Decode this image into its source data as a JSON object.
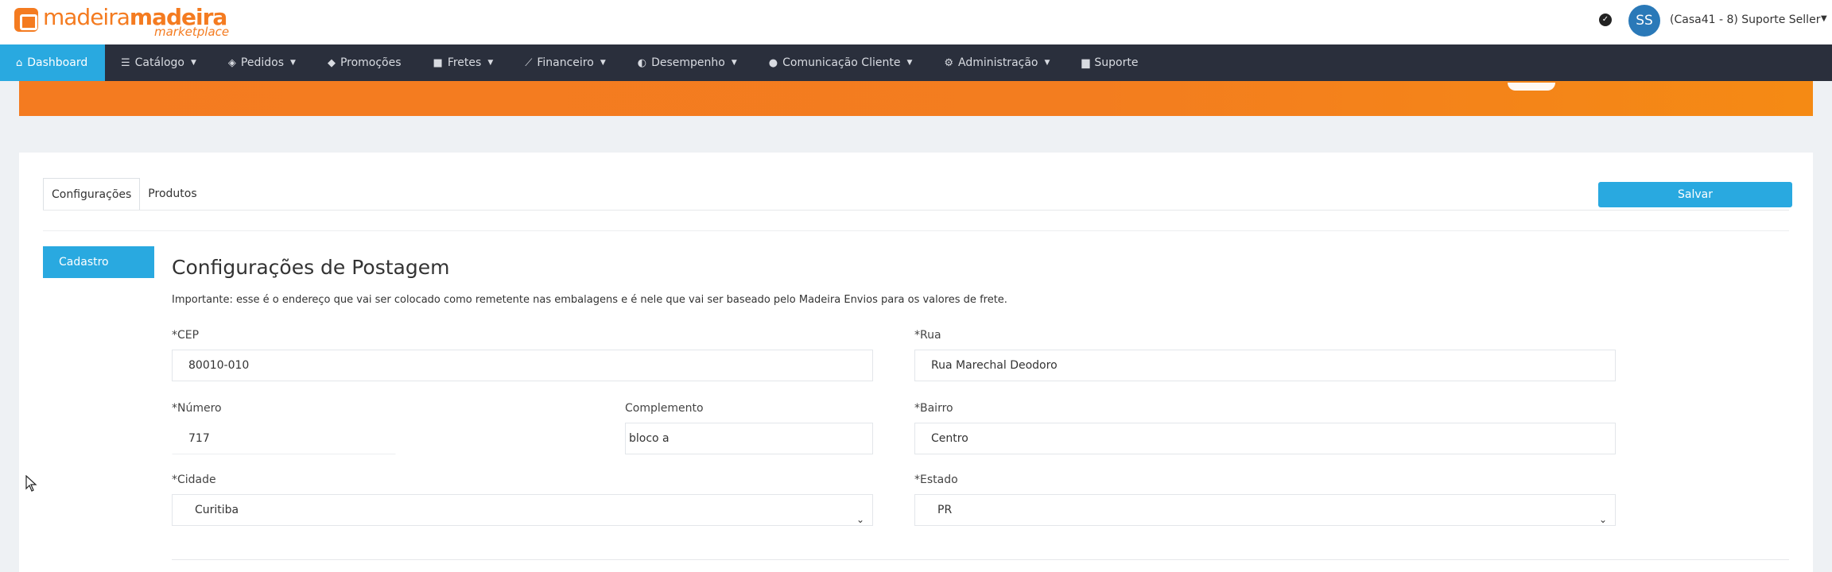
{
  "brand": {
    "name_part1": "madeira",
    "name_part2": "madeira",
    "sub": "marketplace"
  },
  "header": {
    "avatar_initials": "SS",
    "user_name": "(Casa41 - 8) Suporte Seller"
  },
  "nav": [
    {
      "label": "Dashboard",
      "icon": "home-icon"
    },
    {
      "label": "Catálogo",
      "icon": "list-icon"
    },
    {
      "label": "Pedidos",
      "icon": "layers-icon"
    },
    {
      "label": "Promoções",
      "icon": "tag-icon"
    },
    {
      "label": "Fretes",
      "icon": "truck-icon"
    },
    {
      "label": "Financeiro",
      "icon": "chart-icon"
    },
    {
      "label": "Desempenho",
      "icon": "gauge-icon"
    },
    {
      "label": "Comunicação Cliente",
      "icon": "chat-icon"
    },
    {
      "label": "Administração",
      "icon": "gear-icon"
    },
    {
      "label": "Suporte",
      "icon": "message-icon"
    }
  ],
  "tabs": [
    {
      "label": "Configurações"
    },
    {
      "label": "Produtos"
    }
  ],
  "save_label": "Salvar",
  "side_label": "Cadastro",
  "section": {
    "title": "Configurações de Postagem",
    "note": "Importante: esse é o endereço que vai ser colocado como remetente nas embalagens e é nele que vai ser baseado pelo Madeira Envios para os valores de frete."
  },
  "form": {
    "cep": {
      "label": "*CEP",
      "value": "80010-010"
    },
    "rua": {
      "label": "*Rua",
      "value": "Rua Marechal Deodoro"
    },
    "numero": {
      "label": "*Número",
      "value": "717"
    },
    "complemento": {
      "label": "Complemento",
      "value": "bloco a"
    },
    "bairro": {
      "label": "*Bairro",
      "value": "Centro"
    },
    "cidade": {
      "label": "*Cidade",
      "value": "Curitiba"
    },
    "estado": {
      "label": "*Estado",
      "value": "PR"
    }
  },
  "colors": {
    "accent": "#29a9e0",
    "brand": "#f47b20",
    "nav_bg": "#2a2f3c"
  }
}
